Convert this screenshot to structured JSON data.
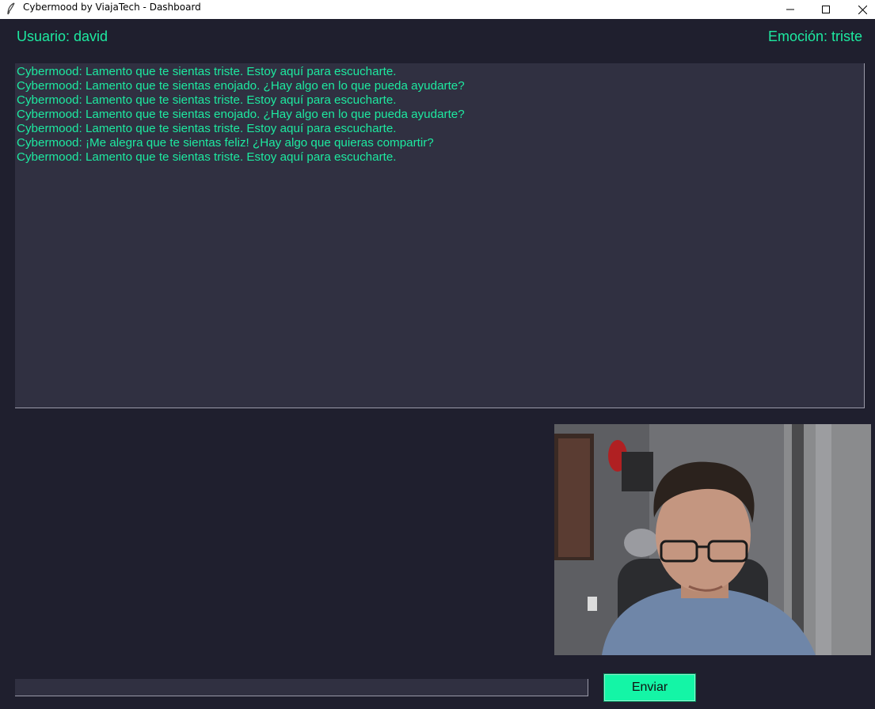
{
  "window": {
    "title": "Cybermood by ViajaTech - Dashboard",
    "icon": "feather-icon"
  },
  "header": {
    "user_label": "Usuario: david",
    "emotion_label": "Emoción: triste"
  },
  "chat": {
    "messages": [
      "Cybermood: Lamento que te sientas triste. Estoy aquí para escucharte.",
      "Cybermood: Lamento que te sientas enojado. ¿Hay algo en lo que pueda ayudarte?",
      "Cybermood: Lamento que te sientas triste. Estoy aquí para escucharte.",
      "Cybermood: Lamento que te sientas enojado. ¿Hay algo en lo que pueda ayudarte?",
      "Cybermood: Lamento que te sientas triste. Estoy aquí para escucharte.",
      "Cybermood: ¡Me alegra que te sientas feliz! ¿Hay algo que quieras compartir?",
      "Cybermood: Lamento que te sientas triste. Estoy aquí para escucharte."
    ]
  },
  "input": {
    "value": "",
    "send_label": "Enviar"
  },
  "colors": {
    "background": "#1f1f2e",
    "panel": "#303041",
    "accent": "#1de9a0",
    "button": "#14f5a6"
  }
}
